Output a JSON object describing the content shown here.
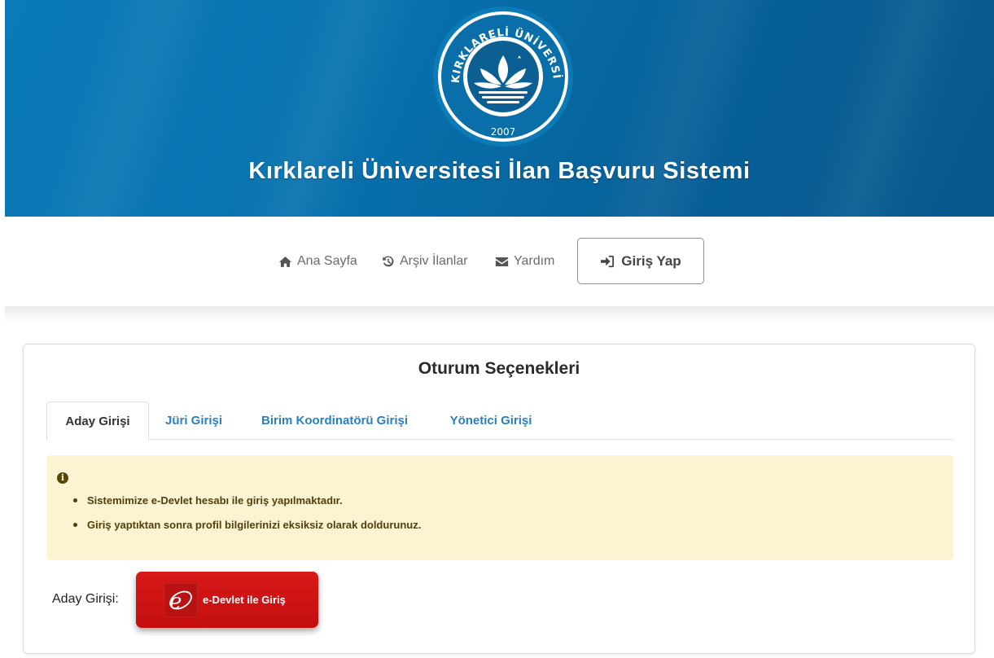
{
  "header": {
    "logo": {
      "top_text": "KIRKLARELİ ÜNİVERSİTESİ",
      "year": "2007"
    },
    "title": "Kırklareli Üniversitesi İlan Başvuru Sistemi",
    "colors": {
      "primary": "#0872ae",
      "dark": "#07578c"
    }
  },
  "nav": {
    "items": [
      {
        "label": "Ana Sayfa",
        "icon": "home-icon"
      },
      {
        "label": "Arşiv İlanlar",
        "icon": "history-icon"
      },
      {
        "label": "Yardım",
        "icon": "envelope-icon"
      }
    ],
    "login_label": "Giriş Yap",
    "login_icon": "sign-in-icon"
  },
  "card": {
    "title": "Oturum Seçenekleri",
    "tabs": [
      {
        "label": "Aday Girişi",
        "active": true
      },
      {
        "label": "Jüri Girişi",
        "active": false
      },
      {
        "label": "Birim Koordinatörü Girişi",
        "active": false
      },
      {
        "label": "Yönetici Girişi",
        "active": false
      }
    ],
    "alert": {
      "icon": "info-icon",
      "items": [
        "Sistemimize e-Devlet hesabı ile giriş yapılmaktadır.",
        "Giriş yaptıktan sonra profil bilgilerinizi eksiksiz olarak doldurunuz."
      ],
      "color": "#fdf3d2"
    },
    "candidate_label": "Aday Girişi:",
    "edevlet_button": "e-Devlet ile Giriş",
    "edevlet_color": "#d81818"
  }
}
